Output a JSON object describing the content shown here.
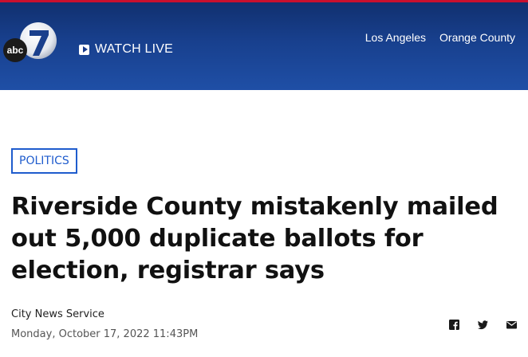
{
  "header": {
    "logo_text": "abc",
    "logo_numeral": "7",
    "watch_live_label": "WATCH LIVE",
    "nav": [
      "Los Angeles",
      "Orange County"
    ]
  },
  "article": {
    "category": "POLITICS",
    "headline": "Riverside County mistakenly mailed out 5,000 duplicate ballots for election, registrar says",
    "byline": "City News Service",
    "timestamp": "Monday, October 17, 2022 11:43PM"
  },
  "share": {
    "icons": [
      "facebook-icon",
      "twitter-icon",
      "email-icon"
    ]
  },
  "colors": {
    "header_blue": "#1a3f8c",
    "accent_blue": "#1f5ccd",
    "top_line": "#c8102e"
  }
}
